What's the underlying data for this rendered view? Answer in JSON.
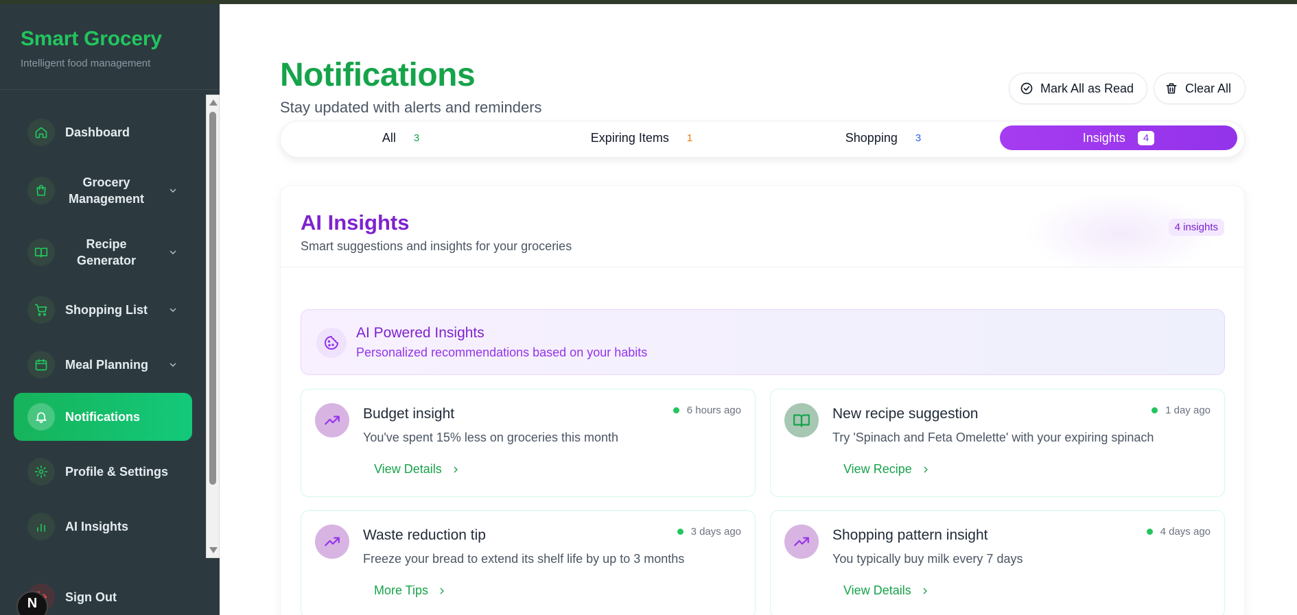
{
  "brand": {
    "title": "Smart Grocery",
    "subtitle": "Intelligent food management"
  },
  "sidebar": {
    "items": [
      {
        "label": "Dashboard",
        "icon": "home-icon",
        "has_children": false,
        "active": false
      },
      {
        "label": "Grocery Management",
        "icon": "shopping-bag-icon",
        "has_children": true,
        "active": false
      },
      {
        "label": "Recipe Generator",
        "icon": "book-open-icon",
        "has_children": true,
        "active": false
      },
      {
        "label": "Shopping List",
        "icon": "cart-icon",
        "has_children": true,
        "active": false
      },
      {
        "label": "Meal Planning",
        "icon": "calendar-icon",
        "has_children": true,
        "active": false
      },
      {
        "label": "Notifications",
        "icon": "bell-icon",
        "has_children": false,
        "active": true
      },
      {
        "label": "Profile & Settings",
        "icon": "gear-icon",
        "has_children": false,
        "active": false
      },
      {
        "label": "AI Insights",
        "icon": "bar-chart-icon",
        "has_children": false,
        "active": false
      }
    ],
    "signout_label": "Sign Out",
    "dev_badge": "N"
  },
  "header": {
    "title": "Notifications",
    "subtitle": "Stay updated with alerts and reminders",
    "mark_all_label": "Mark All as Read",
    "clear_all_label": "Clear All"
  },
  "tabs": [
    {
      "label": "All",
      "count": "3",
      "color": "#16a34a"
    },
    {
      "label": "Expiring Items",
      "count": "1",
      "color": "#ea7a0c"
    },
    {
      "label": "Shopping",
      "count": "3",
      "color": "#2563eb"
    },
    {
      "label": "Insights",
      "count": "4",
      "color": "#9333ea",
      "active": true
    }
  ],
  "panel": {
    "title": "AI Insights",
    "subtitle": "Smart suggestions and insights for your groceries",
    "badge": "4 insights",
    "banner": {
      "title": "AI Powered Insights",
      "subtitle": "Personalized recommendations based on your habits",
      "icon": "cookie-icon"
    },
    "cards": [
      {
        "title": "Budget insight",
        "desc": "You've spent 15% less on groceries this month",
        "time": "6 hours ago",
        "link": "View Details",
        "icon": "trending-up-icon",
        "tone": "purple"
      },
      {
        "title": "New recipe suggestion",
        "desc": "Try 'Spinach and Feta Omelette' with your expiring spinach",
        "time": "1 day ago",
        "link": "View Recipe",
        "icon": "book-open-icon",
        "tone": "green"
      },
      {
        "title": "Waste reduction tip",
        "desc": "Freeze your bread to extend its shelf life by up to 3 months",
        "time": "3 days ago",
        "link": "More Tips",
        "icon": "trending-up-icon",
        "tone": "purple"
      },
      {
        "title": "Shopping pattern insight",
        "desc": "You typically buy milk every 7 days",
        "time": "4 days ago",
        "link": "View Details",
        "icon": "trending-up-icon",
        "tone": "purple"
      }
    ]
  },
  "colors": {
    "brand_green": "#22c55e",
    "active_gradient_start": "#16b35a",
    "insights_purple": "#9333ea",
    "sidebar_bg": "#2c3a40"
  }
}
